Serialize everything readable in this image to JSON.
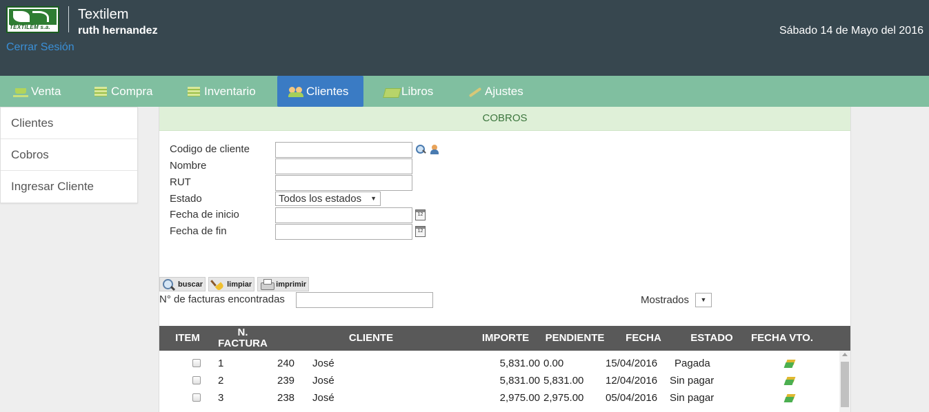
{
  "header": {
    "logo_text": "TEXTILEM s.a.",
    "app_name": "Textilem",
    "user_name": "ruth hernandez",
    "logout_label": "Cerrar Sesión",
    "date": "Sábado 14 de Mayo del 2016",
    "background": "#37474f"
  },
  "nav": {
    "background": "#80bfa0",
    "active_color": "#3a7bc4",
    "items": [
      {
        "label": "Venta",
        "icon": "cart-icon"
      },
      {
        "label": "Compra",
        "icon": "list-icon"
      },
      {
        "label": "Inventario",
        "icon": "list-icon"
      },
      {
        "label": "Clientes",
        "icon": "users-icon",
        "active": true
      },
      {
        "label": "Libros",
        "icon": "book-icon"
      },
      {
        "label": "Ajustes",
        "icon": "wrench-icon"
      }
    ]
  },
  "sidebar": {
    "items": [
      {
        "label": "Clientes"
      },
      {
        "label": "Cobros"
      },
      {
        "label": "Ingresar Cliente"
      }
    ]
  },
  "panel": {
    "title": "COBROS",
    "form": {
      "codigo_label": "Codigo de cliente",
      "codigo_value": "",
      "nombre_label": "Nombre",
      "nombre_value": "",
      "rut_label": "RUT",
      "rut_value": "",
      "estado_label": "Estado",
      "estado_value": "Todos los estados",
      "fecha_inicio_label": "Fecha de inicio",
      "fecha_inicio_value": "",
      "fecha_fin_label": "Fecha de fin",
      "fecha_fin_value": "",
      "calendar_icon_text": "12"
    },
    "toolbar": {
      "buscar_label": "buscar",
      "limpiar_label": "limpiar",
      "imprimir_label": "imprimir"
    },
    "found_label": "N° de facturas encontradas",
    "found_value": "",
    "shown_label": "Mostrados",
    "shown_value": ""
  },
  "table": {
    "headers": {
      "item": "ITEM",
      "factura": "N. FACTURA",
      "cliente": "CLIENTE",
      "importe": "IMPORTE",
      "pendiente": "PENDIENTE",
      "fecha": "FECHA",
      "estado": "ESTADO",
      "vencimiento": "FECHA VTO."
    },
    "rows": [
      {
        "item": "1",
        "factura": "240",
        "cliente": "José",
        "importe": "5,831.00",
        "pendiente": "0.00",
        "fecha": "15/04/2016",
        "estado": "Pagada"
      },
      {
        "item": "2",
        "factura": "239",
        "cliente": "José",
        "importe": "5,831.00",
        "pendiente": "5,831.00",
        "fecha": "12/04/2016",
        "estado": "Sin pagar"
      },
      {
        "item": "3",
        "factura": "238",
        "cliente": "José",
        "importe": "2,975.00",
        "pendiente": "2,975.00",
        "fecha": "05/04/2016",
        "estado": "Sin pagar"
      }
    ]
  }
}
